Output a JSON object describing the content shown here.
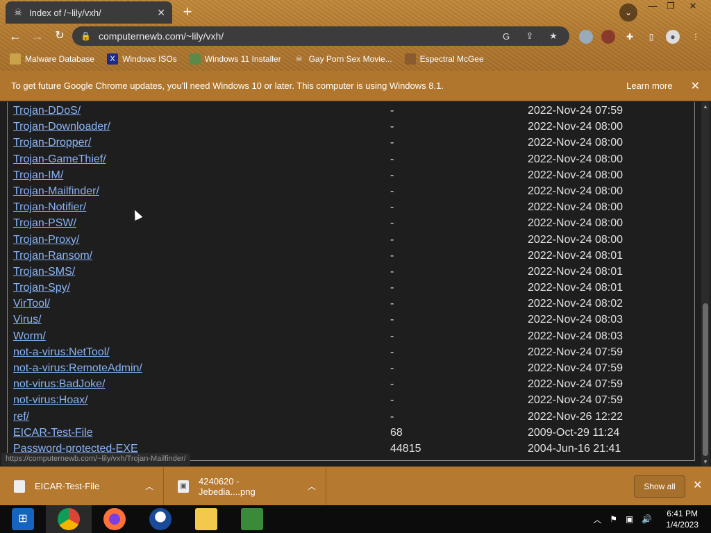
{
  "browser": {
    "tab_title": "Index of /~lily/vxh/",
    "tab_favicon": "skull-icon",
    "url": "computernewb.com/~lily/vxh/",
    "window_controls": [
      "minimize",
      "restore",
      "close"
    ]
  },
  "bookmarks": [
    {
      "label": "Malware Database",
      "icon": "folder-icon"
    },
    {
      "label": "Windows ISOs",
      "icon": "x-logo-icon"
    },
    {
      "label": "Windows 11 Installer",
      "icon": "image-icon"
    },
    {
      "label": "Gay Porn Sex Movie...",
      "icon": "skull-icon"
    },
    {
      "label": "Espectral McGee",
      "icon": "face-icon"
    }
  ],
  "infobar": {
    "message": "To get future Google Chrome updates, you'll need Windows 10 or later. This computer is using Windows 8.1.",
    "learn_more": "Learn more"
  },
  "listing": [
    {
      "name": "Trojan-DDoS/",
      "size": "-",
      "date": "2022-Nov-24 07:59"
    },
    {
      "name": "Trojan-Downloader/",
      "size": "-",
      "date": "2022-Nov-24 08:00"
    },
    {
      "name": "Trojan-Dropper/",
      "size": "-",
      "date": "2022-Nov-24 08:00"
    },
    {
      "name": "Trojan-GameThief/",
      "size": "-",
      "date": "2022-Nov-24 08:00"
    },
    {
      "name": "Trojan-IM/",
      "size": "-",
      "date": "2022-Nov-24 08:00"
    },
    {
      "name": "Trojan-Mailfinder/",
      "size": "-",
      "date": "2022-Nov-24 08:00"
    },
    {
      "name": "Trojan-Notifier/",
      "size": "-",
      "date": "2022-Nov-24 08:00"
    },
    {
      "name": "Trojan-PSW/",
      "size": "-",
      "date": "2022-Nov-24 08:00"
    },
    {
      "name": "Trojan-Proxy/",
      "size": "-",
      "date": "2022-Nov-24 08:00"
    },
    {
      "name": "Trojan-Ransom/",
      "size": "-",
      "date": "2022-Nov-24 08:01"
    },
    {
      "name": "Trojan-SMS/",
      "size": "-",
      "date": "2022-Nov-24 08:01"
    },
    {
      "name": "Trojan-Spy/",
      "size": "-",
      "date": "2022-Nov-24 08:01"
    },
    {
      "name": "VirTool/",
      "size": "-",
      "date": "2022-Nov-24 08:02"
    },
    {
      "name": "Virus/",
      "size": "-",
      "date": "2022-Nov-24 08:03"
    },
    {
      "name": "Worm/",
      "size": "-",
      "date": "2022-Nov-24 08:03"
    },
    {
      "name": "not-a-virus:NetTool/",
      "size": "-",
      "date": "2022-Nov-24 07:59"
    },
    {
      "name": "not-a-virus:RemoteAdmin/",
      "size": "-",
      "date": "2022-Nov-24 07:59"
    },
    {
      "name": "not-virus:BadJoke/",
      "size": "-",
      "date": "2022-Nov-24 07:59"
    },
    {
      "name": "not-virus:Hoax/",
      "size": "-",
      "date": "2022-Nov-24 07:59"
    },
    {
      "name": "ref/",
      "size": "-",
      "date": "2022-Nov-26 12:22"
    },
    {
      "name": "EICAR-Test-File",
      "size": "68",
      "date": "2009-Oct-29 11:24"
    },
    {
      "name": "Password-protected-EXE",
      "size": "44815",
      "date": "2004-Jun-16 21:41"
    }
  ],
  "status_url": "https://computernewb.com/~lily/vxh/Trojan-Mailfinder/",
  "downloads": [
    {
      "name": "EICAR-Test-File",
      "icon": "file-icon"
    },
    {
      "name": "4240620 - Jebedia....png",
      "icon": "image-file-icon"
    }
  ],
  "downloads_show_all": "Show all",
  "taskbar": {
    "apps": [
      "start-icon",
      "chrome-icon",
      "firefox-icon",
      "obama-icon",
      "file-explorer-icon",
      "network-icon"
    ],
    "time": "6:41 PM",
    "date": "1/4/2023"
  },
  "colors": {
    "link": "#8ab4f8",
    "frame": "#b5792f"
  }
}
